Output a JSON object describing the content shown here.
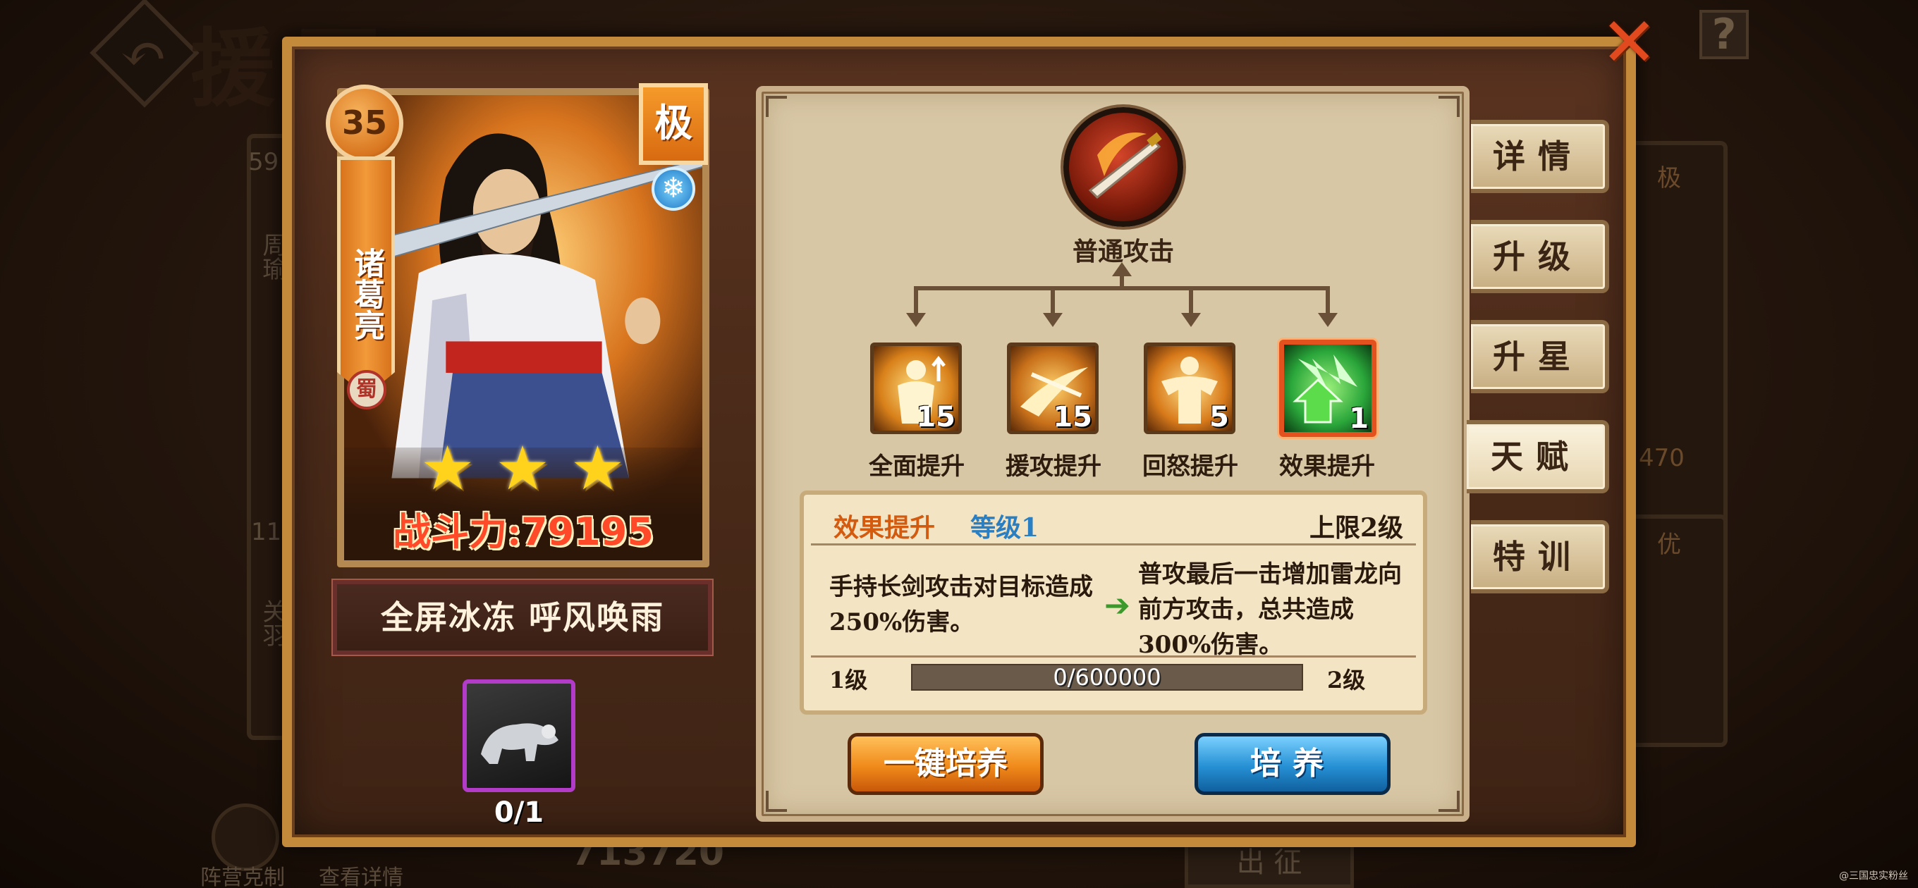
{
  "background": {
    "page_title": "援军",
    "list_cards": [
      {
        "level": "59",
        "name": "周瑜"
      },
      {
        "level": "11",
        "name": "关羽"
      }
    ],
    "bottom_buttons": [
      "阵营克制",
      "查看详情"
    ],
    "total_power_value": "713720",
    "deploy_label": "出 征",
    "right_card_power": "470",
    "right_card_ranks": [
      "极",
      "优"
    ]
  },
  "hero": {
    "level": "35",
    "name": "诸葛亮",
    "faction": "蜀",
    "rank": "极",
    "element_icon": "snowflake-icon",
    "stars": 3,
    "power_label": "战斗力:",
    "power_value": "79195",
    "skills_text": "全屏冰冻  呼风唤雨",
    "item_count": "0/1"
  },
  "talent_tree": {
    "root_label": "普通攻击",
    "nodes": [
      {
        "label": "全面提升",
        "level": "15",
        "icon": "strength-up-icon"
      },
      {
        "label": "援攻提升",
        "level": "15",
        "icon": "assist-attack-icon"
      },
      {
        "label": "回怒提升",
        "level": "5",
        "icon": "rage-recover-icon"
      },
      {
        "label": "效果提升",
        "level": "1",
        "icon": "effect-up-icon"
      }
    ],
    "selected_index": 3
  },
  "detail": {
    "name": "效果提升",
    "level_text": "等级1",
    "cap_text": "上限2级",
    "current_desc": "手持长剑攻击对目标造成250%伤害。",
    "next_desc": "普攻最后一击增加雷龙向前方攻击，总共造成300%伤害。",
    "progress_left": "1级",
    "progress_right": "2级",
    "progress_text": "0/600000",
    "progress_fraction": 0
  },
  "buttons": {
    "one_click": "一键培养",
    "train": "培养"
  },
  "side_tabs": [
    {
      "label": "详情",
      "active": false
    },
    {
      "label": "升级",
      "active": false
    },
    {
      "label": "升星",
      "active": false
    },
    {
      "label": "天赋",
      "active": true
    },
    {
      "label": "特训",
      "active": false
    }
  ],
  "watermark": "@三国忠实粉丝",
  "colors": {
    "frame": "#c28a3a",
    "accent_orange": "#f08a1a",
    "accent_blue": "#2590d4",
    "selected": "#e3521e"
  }
}
